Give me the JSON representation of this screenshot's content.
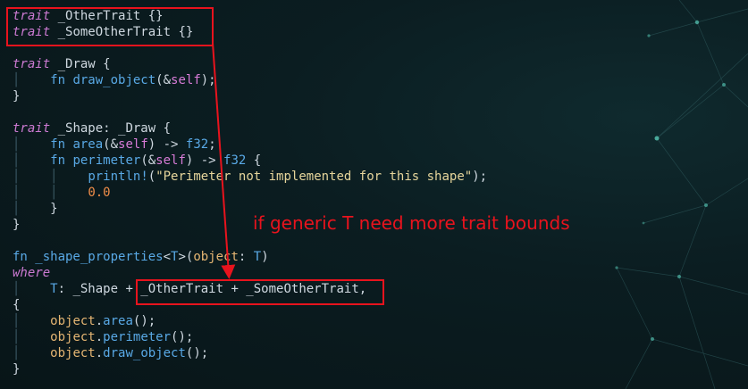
{
  "editor": {
    "code_lines": [
      {
        "k": "trait1",
        "tokens": [
          [
            "kw-i",
            "trait"
          ],
          [
            "ty",
            " _OtherTrait "
          ],
          [
            "pun",
            "{}"
          ]
        ]
      },
      {
        "k": "trait2",
        "tokens": [
          [
            "kw-i",
            "trait"
          ],
          [
            "ty",
            " _SomeOtherTrait "
          ],
          [
            "pun",
            "{}"
          ]
        ]
      },
      {
        "k": "blank1",
        "tokens": []
      },
      {
        "k": "draw",
        "tokens": [
          [
            "kw-i",
            "trait"
          ],
          [
            "ty",
            " _Draw "
          ],
          [
            "pun",
            "{"
          ]
        ]
      },
      {
        "k": "draw_fn",
        "tokens": [
          [
            "guide",
            "│"
          ],
          [
            "pun",
            "    "
          ],
          [
            "kw",
            "fn"
          ],
          [
            "fn",
            " draw_object"
          ],
          [
            "pun",
            "(&"
          ],
          [
            "self",
            "self"
          ],
          [
            "pun",
            ");"
          ]
        ]
      },
      {
        "k": "draw_end",
        "tokens": [
          [
            "pun",
            "}"
          ]
        ]
      },
      {
        "k": "blank2",
        "tokens": []
      },
      {
        "k": "shape",
        "tokens": [
          [
            "kw-i",
            "trait"
          ],
          [
            "ty",
            " _Shape: _Draw "
          ],
          [
            "pun",
            "{"
          ]
        ]
      },
      {
        "k": "area",
        "tokens": [
          [
            "guide",
            "│"
          ],
          [
            "pun",
            "    "
          ],
          [
            "kw",
            "fn"
          ],
          [
            "fn",
            " area"
          ],
          [
            "pun",
            "(&"
          ],
          [
            "self",
            "self"
          ],
          [
            "pun",
            ") -> "
          ],
          [
            "kw",
            "f32"
          ],
          [
            "pun",
            ";"
          ]
        ]
      },
      {
        "k": "perim",
        "tokens": [
          [
            "guide",
            "│"
          ],
          [
            "pun",
            "    "
          ],
          [
            "kw",
            "fn"
          ],
          [
            "fn",
            " perimeter"
          ],
          [
            "pun",
            "(&"
          ],
          [
            "self",
            "self"
          ],
          [
            "pun",
            ") -> "
          ],
          [
            "kw",
            "f32"
          ],
          [
            "pun",
            " {"
          ]
        ]
      },
      {
        "k": "println",
        "tokens": [
          [
            "guide",
            "│"
          ],
          [
            "pun",
            "    "
          ],
          [
            "guide",
            "│"
          ],
          [
            "pun",
            "    "
          ],
          [
            "fn",
            "println!"
          ],
          [
            "pun",
            "("
          ],
          [
            "str",
            "\"Perimeter not implemented for this shape\""
          ],
          [
            "pun",
            ");"
          ]
        ]
      },
      {
        "k": "zero",
        "tokens": [
          [
            "guide",
            "│"
          ],
          [
            "pun",
            "    "
          ],
          [
            "guide",
            "│"
          ],
          [
            "pun",
            "    "
          ],
          [
            "num",
            "0.0"
          ]
        ]
      },
      {
        "k": "perim_end",
        "tokens": [
          [
            "guide",
            "│"
          ],
          [
            "pun",
            "    }"
          ]
        ]
      },
      {
        "k": "shape_end",
        "tokens": [
          [
            "pun",
            "}"
          ]
        ]
      },
      {
        "k": "blank3",
        "tokens": []
      },
      {
        "k": "props",
        "tokens": [
          [
            "kw",
            "fn"
          ],
          [
            "fn",
            " _shape_properties"
          ],
          [
            "pun",
            "<"
          ],
          [
            "kw",
            "T"
          ],
          [
            "pun",
            ">("
          ],
          [
            "var",
            "object"
          ],
          [
            "pun",
            ": "
          ],
          [
            "kw",
            "T"
          ],
          [
            "pun",
            ")"
          ]
        ]
      },
      {
        "k": "where",
        "tokens": [
          [
            "kw-i",
            "where"
          ]
        ]
      },
      {
        "k": "bounds",
        "tokens": [
          [
            "guide",
            "│"
          ],
          [
            "pun",
            "    "
          ],
          [
            "kw",
            "T"
          ],
          [
            "pun",
            ": _Shape + _OtherTrait + _SomeOtherTrait,"
          ]
        ]
      },
      {
        "k": "open",
        "tokens": [
          [
            "pun",
            "{"
          ]
        ]
      },
      {
        "k": "call_area",
        "tokens": [
          [
            "guide",
            "│"
          ],
          [
            "pun",
            "    "
          ],
          [
            "var",
            "object"
          ],
          [
            "pun",
            "."
          ],
          [
            "fn",
            "area"
          ],
          [
            "pun",
            "();"
          ]
        ]
      },
      {
        "k": "call_perim",
        "tokens": [
          [
            "guide",
            "│"
          ],
          [
            "pun",
            "    "
          ],
          [
            "var",
            "object"
          ],
          [
            "pun",
            "."
          ],
          [
            "fn",
            "perimeter"
          ],
          [
            "pun",
            "();"
          ]
        ]
      },
      {
        "k": "call_draw",
        "tokens": [
          [
            "guide",
            "│"
          ],
          [
            "pun",
            "    "
          ],
          [
            "var",
            "object"
          ],
          [
            "pun",
            "."
          ],
          [
            "fn",
            "draw_object"
          ],
          [
            "pun",
            "();"
          ]
        ]
      },
      {
        "k": "close",
        "tokens": [
          [
            "pun",
            "}"
          ]
        ]
      }
    ]
  },
  "annotation": {
    "text": "if generic T need more trait bounds",
    "color": "#e8131d"
  },
  "colors": {
    "keyword": "#59a9e6",
    "italic_keyword": "#cc7ad2",
    "string": "#e6d59b",
    "number": "#f08d49",
    "variable": "#e6b673",
    "highlight": "#e8131d"
  }
}
